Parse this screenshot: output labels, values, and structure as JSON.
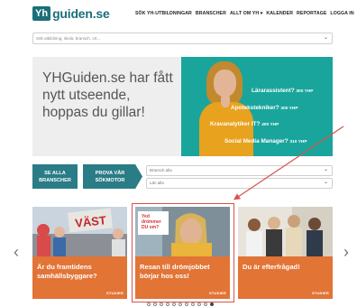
{
  "header": {
    "logo_box": "Yh",
    "logo_text": "guiden.se",
    "nav": [
      "SÖK YH-UTBILDNINGAR",
      "BRANSCHER",
      "ALLT OM YH",
      "KALENDER",
      "REPORTAGE",
      "LOGGA IN"
    ]
  },
  "search": {
    "placeholder": "Sök utbildning, skola, bransch, ort..."
  },
  "hero": {
    "title": "YHGuiden.se har fått nytt utseende, hoppas du gillar!",
    "items": [
      {
        "role": "Lärarassistent?",
        "salary": "300 YHP"
      },
      {
        "role": "Apotekstekniker?",
        "salary": "300 YHP"
      },
      {
        "role": "Kravanalytiker IT?",
        "salary": "400 YHP"
      },
      {
        "role": "Social Media Manager?",
        "salary": "310 YHP"
      }
    ]
  },
  "buttons": {
    "all_industries": "SE ALLA BRANSCHER",
    "try_search": "PROVA VÅR SÖKMOTOR"
  },
  "selects": {
    "industry": "Bransch alla",
    "county": "Län alla"
  },
  "cards": [
    {
      "title": "Är du framtidens samhällsbyggare?",
      "tag": "STUDIER",
      "sign": "VÄST"
    },
    {
      "title": "Resan till drömjobbet börjar hos oss!",
      "tag": "STUDIER",
      "bubble": "Yed drömmer DU om?"
    },
    {
      "title": "Du är efterfrågad!",
      "tag": "STUDIER"
    }
  ],
  "carousel": {
    "dots": 11,
    "active_dot": 10
  },
  "colors": {
    "brand": "#1b6f7a",
    "hero_teal": "#1aa59c",
    "card_orange": "#e27436",
    "highlight": "#d9534a"
  }
}
